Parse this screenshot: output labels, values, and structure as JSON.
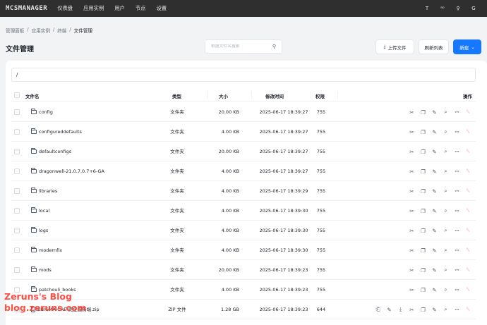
{
  "header": {
    "logo": "MCSMANAGER",
    "nav": [
      "仪表盘",
      "应用实例",
      "用户",
      "节点",
      "设置"
    ],
    "right_icons": [
      {
        "name": "theme-icon",
        "glyph": "Τ"
      },
      {
        "name": "language-icon",
        "glyph": "ᵃᵖ"
      },
      {
        "name": "user-icon",
        "glyph": "♀"
      },
      {
        "name": "logout-icon",
        "glyph": "G"
      }
    ]
  },
  "breadcrumb": {
    "items": [
      "管理面板",
      "应用实例",
      "终端"
    ],
    "separator": "/",
    "current": "文件管理"
  },
  "page": {
    "title": "文件管理"
  },
  "search": {
    "placeholder": "根据文件名搜索",
    "value": ""
  },
  "toolbar": {
    "upload_label": "上传文件",
    "refresh_label": "刷新列表",
    "new_label": "新建"
  },
  "path": {
    "value": "/"
  },
  "table": {
    "headers": {
      "name": "文件名",
      "type": "类型",
      "size": "大小",
      "mtime": "修改时间",
      "perm": "权限",
      "actions": "操作"
    },
    "rows": [
      {
        "name": "config",
        "type": "文件夹",
        "size": "20.00 KB",
        "mtime": "2025-06-17 18:39:27",
        "perm": "755",
        "kind": "folder"
      },
      {
        "name": "configureddefaults",
        "type": "文件夹",
        "size": "4.00 KB",
        "mtime": "2025-06-17 18:39:27",
        "perm": "755",
        "kind": "folder"
      },
      {
        "name": "defaultconfigs",
        "type": "文件夹",
        "size": "20.00 KB",
        "mtime": "2025-06-17 18:39:27",
        "perm": "755",
        "kind": "folder"
      },
      {
        "name": "dragonwell-21.0.7.0.7+6-GA",
        "type": "文件夹",
        "size": "4.00 KB",
        "mtime": "2025-06-17 18:39:27",
        "perm": "755",
        "kind": "folder"
      },
      {
        "name": "libraries",
        "type": "文件夹",
        "size": "4.00 KB",
        "mtime": "2025-06-17 18:39:29",
        "perm": "755",
        "kind": "folder"
      },
      {
        "name": "local",
        "type": "文件夹",
        "size": "4.00 KB",
        "mtime": "2025-06-17 18:39:30",
        "perm": "755",
        "kind": "folder"
      },
      {
        "name": "logs",
        "type": "文件夹",
        "size": "4.00 KB",
        "mtime": "2025-06-17 18:39:30",
        "perm": "755",
        "kind": "folder"
      },
      {
        "name": "modernfix",
        "type": "文件夹",
        "size": "4.00 KB",
        "mtime": "2025-06-17 18:39:30",
        "perm": "755",
        "kind": "folder"
      },
      {
        "name": "mods",
        "type": "文件夹",
        "size": "20.00 KB",
        "mtime": "2025-06-17 18:39:23",
        "perm": "755",
        "kind": "folder"
      },
      {
        "name": "patchouli_books",
        "type": "文件夹",
        "size": "4.00 KB",
        "mtime": "2025-06-17 18:39:23",
        "perm": "755",
        "kind": "folder"
      },
      {
        "name": "ENIGMA-CRE-完全服务端.zip",
        "type": "ZIP 文件",
        "size": "1.28 GB",
        "mtime": "2025-06-17 18:39:23",
        "perm": "644",
        "kind": "file"
      }
    ],
    "folder_actions": [
      {
        "name": "cut-icon",
        "glyph": "✂"
      },
      {
        "name": "copy-icon",
        "glyph": "❐"
      },
      {
        "name": "rename-icon",
        "glyph": "✎"
      },
      {
        "name": "search-file-icon",
        "glyph": "⌕"
      },
      {
        "name": "compress-icon",
        "glyph": "⎓"
      },
      {
        "name": "delete-icon",
        "glyph": "␡"
      }
    ],
    "file_actions": [
      {
        "name": "open-icon",
        "glyph": "⎗"
      },
      {
        "name": "edit-icon",
        "glyph": "✎"
      },
      {
        "name": "download-icon",
        "glyph": "⤓"
      },
      {
        "name": "cut-icon",
        "glyph": "✂"
      },
      {
        "name": "copy-icon",
        "glyph": "❐"
      },
      {
        "name": "rename-icon",
        "glyph": "✎"
      },
      {
        "name": "search-file-icon",
        "glyph": "⌕"
      },
      {
        "name": "compress-icon",
        "glyph": "⎓"
      },
      {
        "name": "delete-icon",
        "glyph": "␡"
      }
    ]
  },
  "watermark": {
    "line1": "Zeruns's Blog",
    "line2": "blog.zeruns.com"
  },
  "colors": {
    "topbar": "#2f2f2f",
    "accent": "#1677ff",
    "danger": "#f53f3f"
  }
}
